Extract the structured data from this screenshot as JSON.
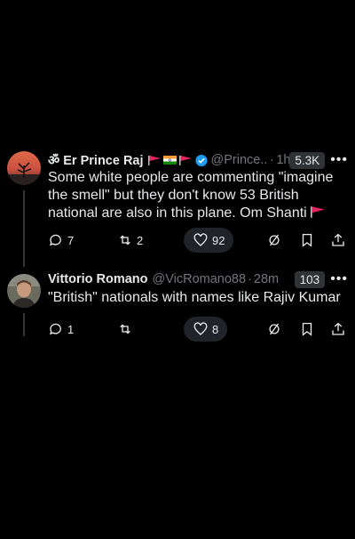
{
  "tweets": [
    {
      "name": "ॐ Er Prince Raj",
      "handle": "@Prince...",
      "time": "1h",
      "views": "5.3K",
      "text": "Some white people are commenting \"imagine the smell\" but they don't know 53 British national are also in this plane. Om Shanti",
      "replies": "7",
      "reposts": "2",
      "likes": "92"
    },
    {
      "name": "Vittorio Romano",
      "handle": "@VicRomano88",
      "time": "28m",
      "views": "103",
      "text": "\"British\" nationals with names like Rajiv Kumar",
      "replies": "1",
      "reposts": "",
      "likes": "8"
    }
  ],
  "separator": "·",
  "more_label": "•••",
  "colors": {
    "background": "#000000",
    "text": "#e7e9ea",
    "muted": "#71767b",
    "verified": "#1d9bf0",
    "flag_red": "#e0245e"
  },
  "icons": [
    "reply-icon",
    "repost-icon",
    "like-icon",
    "grok-icon",
    "bookmark-icon",
    "share-icon",
    "verified-icon",
    "red-flag-icon",
    "india-flag-icon"
  ]
}
